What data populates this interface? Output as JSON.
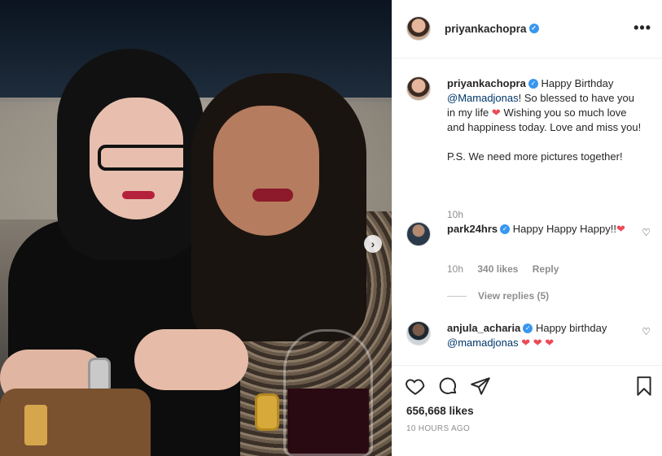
{
  "post": {
    "username": "priyankachopra",
    "more_icon": "more-options-icon"
  },
  "caption": {
    "username": "priyankachopra",
    "text_parts": {
      "pre": "Happy Birthday",
      "mention": "@Mamadjonas",
      "line1": "! So blessed to have you in my life",
      "line2": "Wishing you so much love and happiness today. Love and miss you!",
      "ps": "P.S. We need more pictures together!"
    },
    "time": "10h"
  },
  "comments": [
    {
      "username": "park24hrs",
      "text": "Happy Happy Happy!!",
      "time": "10h",
      "likes": "340 likes",
      "reply_label": "Reply",
      "view_replies": "View replies (5)"
    },
    {
      "username": "anjula_acharia",
      "text_pre": "Happy birthday",
      "mention": "@mamadjonas"
    }
  ],
  "footer": {
    "likes": "656,668 likes",
    "posted": "10 HOURS AGO"
  },
  "colors": {
    "verified": "#3897f0",
    "heart": "#ed4956",
    "muted": "#8e8e8e",
    "mention": "#00376b"
  }
}
